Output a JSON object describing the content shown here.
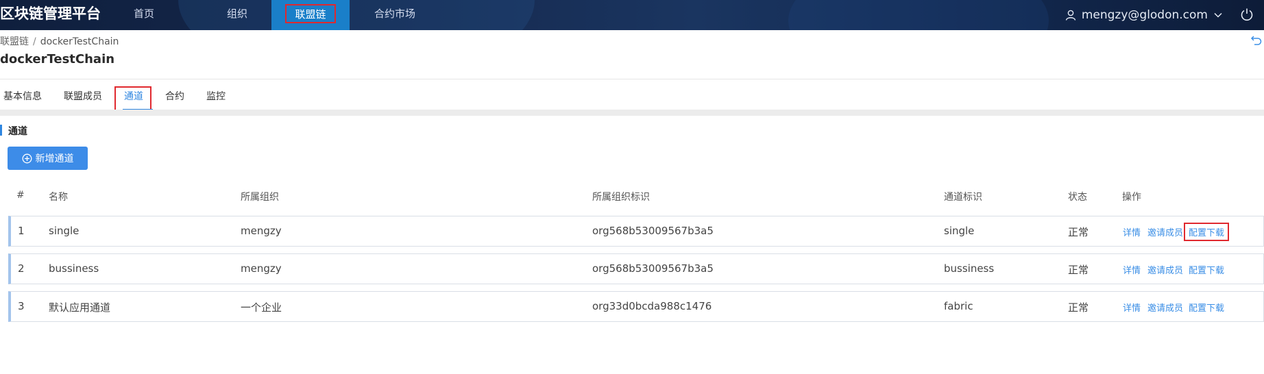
{
  "topbar": {
    "brand": "区块链管理平台",
    "nav": [
      "首页",
      "组织",
      "联盟链",
      "合约市场"
    ],
    "active_nav": "联盟链",
    "user_email": "mengzy@glodon.com"
  },
  "header": {
    "breadcrumb_parent": "联盟链",
    "breadcrumb_separator": "/",
    "breadcrumb_current": "dockerTestChain",
    "title": "dockerTestChain"
  },
  "tabs": [
    "基本信息",
    "联盟成员",
    "通道",
    "合约",
    "监控"
  ],
  "active_tab": "通道",
  "section": {
    "title": "通道",
    "add_button": "新增通道"
  },
  "table": {
    "columns": [
      "#",
      "名称",
      "所属组织",
      "所属组织标识",
      "通道标识",
      "状态",
      "操作"
    ],
    "rows": [
      {
        "index": "1",
        "name": "single",
        "org": "mengzy",
        "org_id": "org568b53009567b3a5",
        "channel_id": "single",
        "status": "正常"
      },
      {
        "index": "2",
        "name": "bussiness",
        "org": "mengzy",
        "org_id": "org568b53009567b3a5",
        "channel_id": "bussiness",
        "status": "正常"
      },
      {
        "index": "3",
        "name": "默认应用通道",
        "org": "一个企业",
        "org_id": "org33d0bcda988c1476",
        "channel_id": "fabric",
        "status": "正常"
      }
    ],
    "actions": [
      "详情",
      "邀请成员",
      "配置下载"
    ]
  },
  "colors": {
    "topbar_bg": "#15284d",
    "active_nav_bg": "#1a7fc9",
    "accent": "#2f86e0",
    "button_bg": "#3d8ce8",
    "highlight_box": "#e0282e"
  },
  "icons": [
    "user-icon",
    "chevron-down-icon",
    "power-icon",
    "back-icon",
    "plus-circle-icon"
  ]
}
